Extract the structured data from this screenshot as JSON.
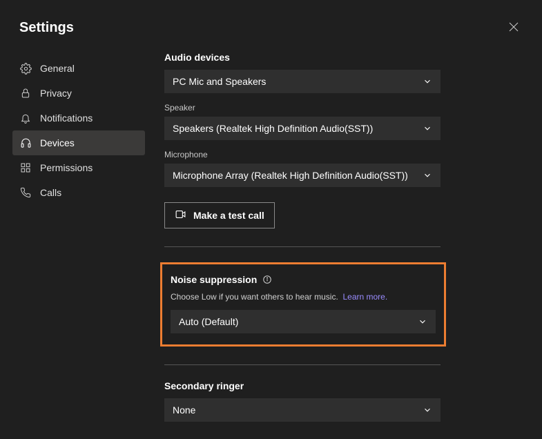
{
  "header": {
    "title": "Settings"
  },
  "sidebar": {
    "items": [
      {
        "label": "General"
      },
      {
        "label": "Privacy"
      },
      {
        "label": "Notifications"
      },
      {
        "label": "Devices"
      },
      {
        "label": "Permissions"
      },
      {
        "label": "Calls"
      }
    ],
    "active_index": 3
  },
  "audio_devices": {
    "heading": "Audio devices",
    "device_select": "PC Mic and Speakers",
    "speaker_label": "Speaker",
    "speaker_select": "Speakers (Realtek High Definition Audio(SST))",
    "microphone_label": "Microphone",
    "microphone_select": "Microphone Array (Realtek High Definition Audio(SST))",
    "test_call_label": "Make a test call"
  },
  "noise_suppression": {
    "heading": "Noise suppression",
    "help_text": "Choose Low if you want others to hear music.",
    "learn_more": "Learn more.",
    "select_value": "Auto (Default)"
  },
  "secondary_ringer": {
    "heading": "Secondary ringer",
    "select_value": "None"
  }
}
